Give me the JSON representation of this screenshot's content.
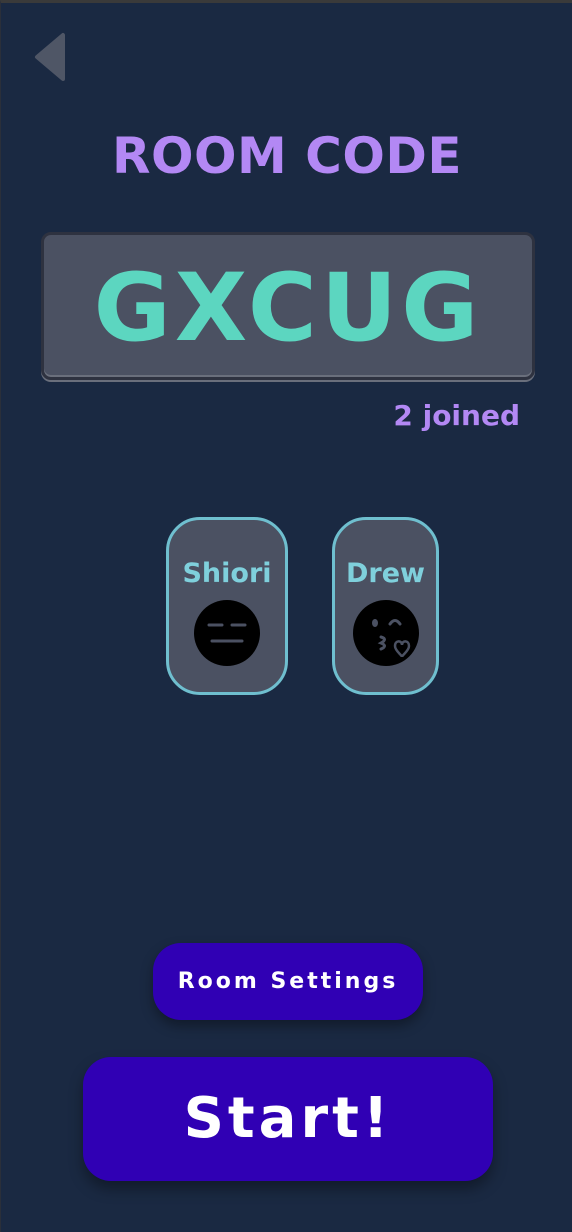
{
  "header": {
    "back_icon": "triangle-left-icon",
    "title": "ROOM CODE"
  },
  "room": {
    "code": "GXCUG",
    "joined_label": "2 joined"
  },
  "players": [
    {
      "name": "Shiori",
      "emoji": "expressionless-face-icon"
    },
    {
      "name": "Drew",
      "emoji": "face-blowing-kiss-icon"
    }
  ],
  "actions": {
    "settings_label": "Room Settings",
    "start_label": "Start!"
  },
  "colors": {
    "background": "#1a2942",
    "accent_purple": "#b388f4",
    "code_teal": "#5cd6c0",
    "card_bg": "#4b5162",
    "card_border": "#6fbfcf",
    "button_bg": "#3000b4"
  }
}
